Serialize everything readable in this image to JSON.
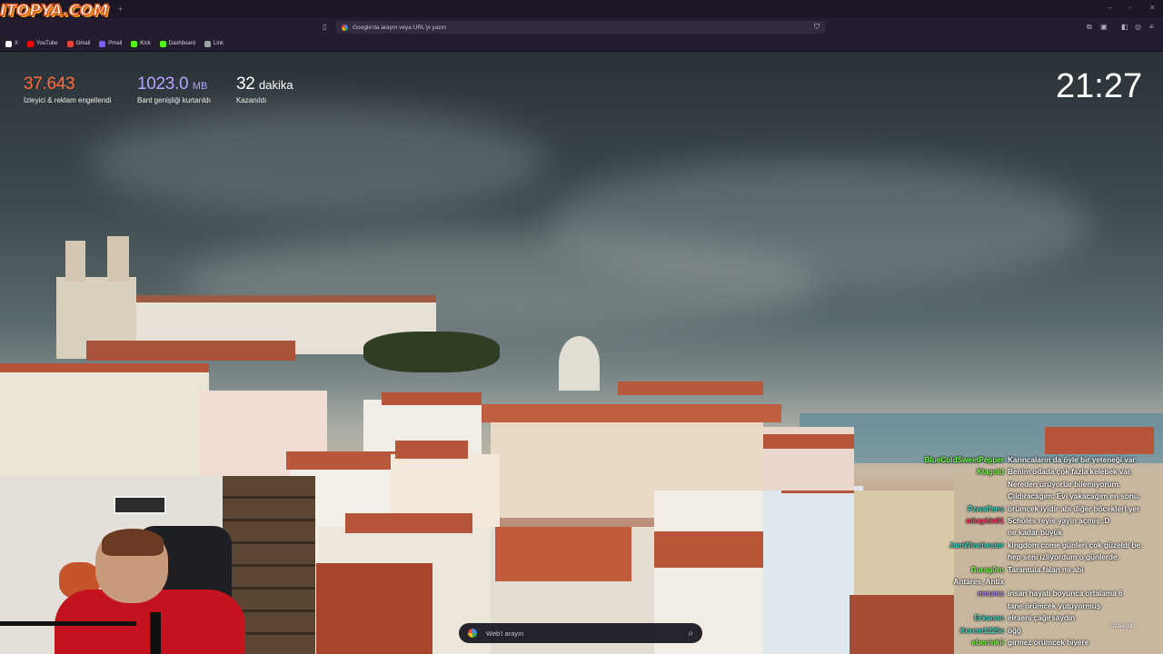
{
  "logo": {
    "text": "ITOPYA.COM"
  },
  "browser": {
    "nav": {
      "back": "‹",
      "forward": "›",
      "reload": "↻"
    },
    "address": {
      "placeholder": "Google'da arayın veya URL'yi yazın"
    },
    "bookmarks": [
      {
        "label": "X",
        "color": "#ffffff"
      },
      {
        "label": "YouTube",
        "color": "#ff0000"
      },
      {
        "label": "Gmail",
        "color": "#ea4335"
      },
      {
        "label": "Pmail",
        "color": "#7b5cff"
      },
      {
        "label": "Kick",
        "color": "#53fc18"
      },
      {
        "label": "Dashboard",
        "color": "#53fc18"
      },
      {
        "label": "Link",
        "color": "#9aa0a6"
      }
    ]
  },
  "stats": [
    {
      "value": "37.643",
      "unit": "",
      "label": "İzleyici & reklam engellendi",
      "color": "#ff6a3d"
    },
    {
      "value": "1023.0",
      "unit": "MB",
      "label": "Bant genişliği kurtarıldı",
      "color": "#b6a4ff"
    },
    {
      "value": "32",
      "unit": "dakika",
      "label": "Kazanıldı",
      "color": "#ffffff"
    }
  ],
  "clock": {
    "time": "21:27"
  },
  "chat": {
    "messages": [
      {
        "user": "BlueColdSweetPepper",
        "text": "Karıncaların da öyle bir yeteneği var",
        "color": "#7cff4c"
      },
      {
        "user": "Klagold",
        "text": "Benim odada çok fazla kelebek var.",
        "color": "#7cff4c"
      },
      {
        "user": "",
        "text": "Nereden ürüyorlar bilemiyorum.",
        "color": "#7cff4c"
      },
      {
        "user": "",
        "text": "Çıldıracağım. Evi yakacağım en sonu.",
        "color": "#7cff4c"
      },
      {
        "user": "Pzwaffens",
        "text": "örümcek iyidir abi diğer böcekleri yer",
        "color": "#3fd6c6"
      },
      {
        "user": "mkaykin01",
        "text": "Scholes reyis yayın açmış :D",
        "color": "#ff3b6b"
      },
      {
        "user": "",
        "text": "ne kadar büyük",
        "color": "#ff3b6b"
      },
      {
        "user": "JamWinchester",
        "text": "kingdom come günleri çok güzeldi be.",
        "color": "#3fd6c6"
      },
      {
        "user": "",
        "text": "hep seni izliyordum o günlerde.",
        "color": "#3fd6c6"
      },
      {
        "user": "Burag0rn",
        "text": "Tarantula falan mı abi",
        "color": "#7cff4c"
      },
      {
        "user": "Antares_Antix",
        "text": "",
        "color": "#ffffff"
      },
      {
        "user": "mnumc",
        "text": "insan hayatı boyunca ortalama 6",
        "color": "#b38bff"
      },
      {
        "user": "",
        "text": "tane örümcek yutuyormuş",
        "color": "#b38bff"
      },
      {
        "user": "Erkannn",
        "text": "elraeni çağırsaydın",
        "color": "#3fd6c6"
      },
      {
        "user": "Kerem1225e",
        "text": "öğğ",
        "color": "#3fd6c6"
      },
      {
        "user": "ebeninkii",
        "text": "girmez örümcek biyere",
        "color": "#7cff4c"
      }
    ],
    "customize_label": "Özelleştir"
  },
  "search": {
    "placeholder": "Web'i arayın"
  }
}
